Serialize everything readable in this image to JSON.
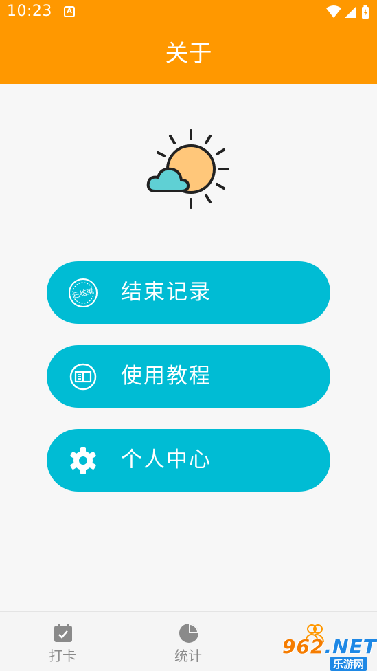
{
  "status_bar": {
    "time": "10:23",
    "notification_icon": "A"
  },
  "app_bar": {
    "title": "关于"
  },
  "hero": {
    "icon": "sun-cloud-icon"
  },
  "menu": {
    "items": [
      {
        "label": "结束记录",
        "icon": "ended-stamp-icon",
        "stamp_text": "已结束"
      },
      {
        "label": "使用教程",
        "icon": "book-tutorial-icon"
      },
      {
        "label": "个人中心",
        "icon": "gear-icon"
      }
    ]
  },
  "bottom_nav": {
    "items": [
      {
        "label": "打卡",
        "icon": "calendar-check-icon",
        "active": false
      },
      {
        "label": "统计",
        "icon": "pie-chart-icon",
        "active": false
      },
      {
        "label": "",
        "icon": "people-icon",
        "active": true
      }
    ]
  },
  "watermark": {
    "main_prefix": "962",
    "main_suffix": ".NET",
    "sub": "乐游网"
  },
  "colors": {
    "primary": "#ff9800",
    "accent": "#00bcd4",
    "background": "#f7f7f7",
    "nav_inactive": "#8a8a8a"
  }
}
